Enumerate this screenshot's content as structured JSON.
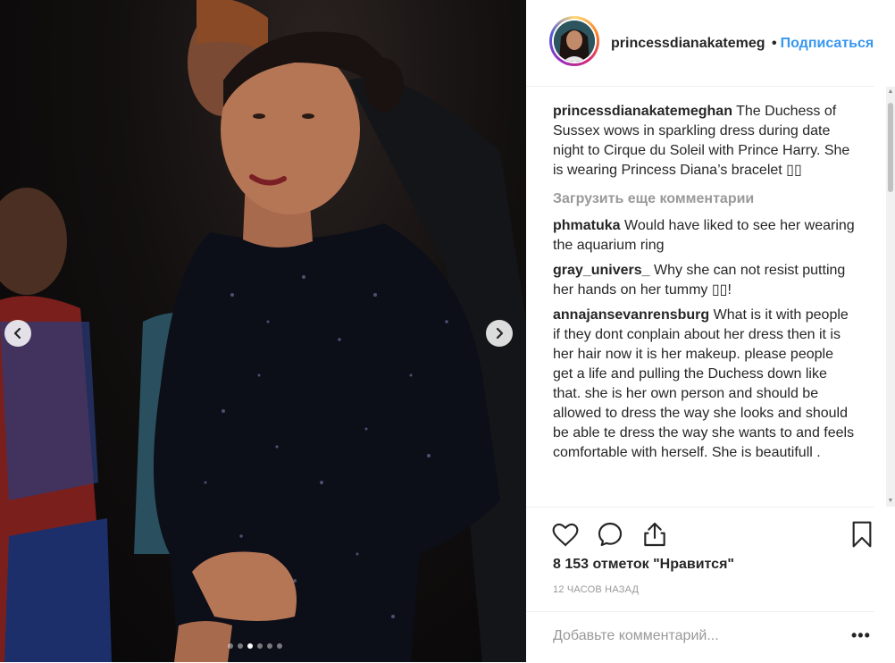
{
  "photo": {
    "carousel_count": 6,
    "carousel_active": 3
  },
  "header": {
    "username": "princessdianakatemeg",
    "bullet": "•",
    "follow_label": "Подписаться"
  },
  "caption": {
    "username": "princessdianakatemeghan",
    "text": "The Duchess of Sussex wows in sparkling dress during date night to Cirque du Soleil with Prince Harry. She is wearing Princess Diana’s bracelet ▯▯"
  },
  "load_more": "Загрузить еще комментарии",
  "comments": [
    {
      "username": "phmatuka",
      "text": "Would have liked to see her wearing the aquarium ring"
    },
    {
      "username": "gray_univers_",
      "text": "Why she can not resist putting her hands on her tummy ▯▯!"
    },
    {
      "username": "annajansevanrensburg",
      "text": "What is it with people if they dont conplain about her dress then it is her hair now it is her makeup. please people get a life and pulling the Duchess down like that. she is her own person and should be allowed to dress the way she looks and should be able te dress the way she wants to and feels comfortable with herself. She is beautifull ."
    }
  ],
  "likes": "8 153 отметок \"Нравится\"",
  "timestamp": "12 ЧАСОВ НАЗАД",
  "add_comment_placeholder": "Добавьте комментарий...",
  "more_label": "•••",
  "icons": {
    "like": "heart-icon",
    "comment": "comment-icon",
    "share": "share-icon",
    "save": "bookmark-icon",
    "prev": "chevron-left-icon",
    "next": "chevron-right-icon"
  },
  "colors": {
    "accent": "#3897f0",
    "muted": "#999999",
    "text": "#262626"
  }
}
